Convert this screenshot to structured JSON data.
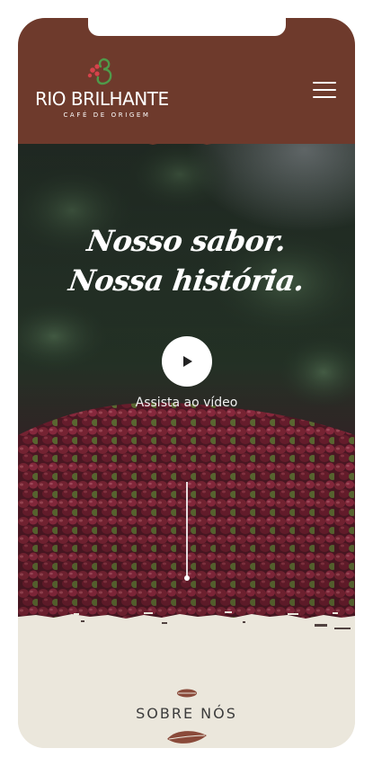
{
  "header": {
    "brand_name": "RIO BRILHANTE",
    "brand_tagline": "CAFÉ DE ORIGEM",
    "logo_icon": "coffee-branch-logo-icon",
    "menu_icon": "hamburger-menu-icon"
  },
  "hero": {
    "title_line_1": "Nosso sabor.",
    "title_line_2": "Nossa história.",
    "play_icon": "play-icon",
    "video_label": "Assista ao vídeo",
    "scroll_indicator": "scroll-down-indicator"
  },
  "about": {
    "title": "SOBRE NÓS",
    "leaf_icon": "coffee-leaf-icon"
  },
  "colors": {
    "header_brown": "#6e3a2c",
    "cream": "#ebe7dc",
    "logo_green": "#4f9a4a",
    "logo_red": "#d6424b",
    "leaf_brown": "#8a4a3a"
  }
}
